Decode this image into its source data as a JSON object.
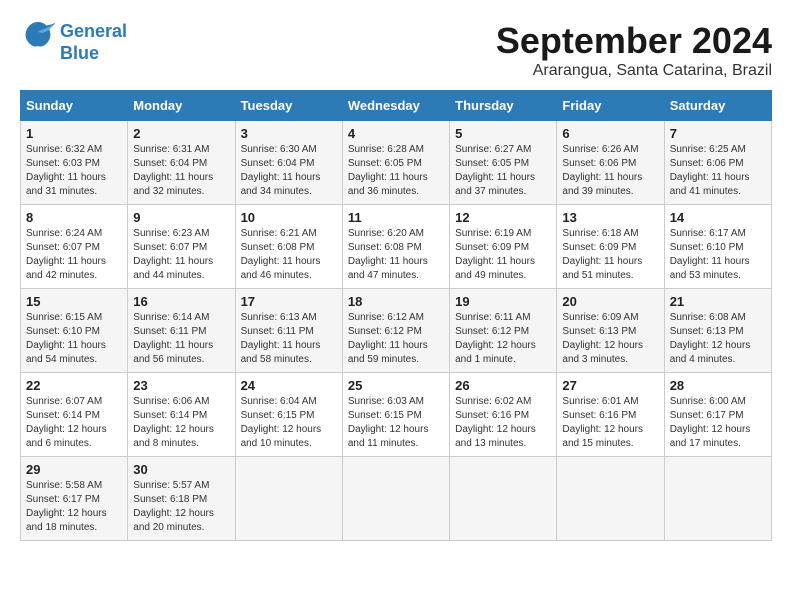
{
  "header": {
    "logo_line1": "General",
    "logo_line2": "Blue",
    "month_year": "September 2024",
    "location": "Ararangua, Santa Catarina, Brazil"
  },
  "weekdays": [
    "Sunday",
    "Monday",
    "Tuesday",
    "Wednesday",
    "Thursday",
    "Friday",
    "Saturday"
  ],
  "weeks": [
    [
      {
        "day": "1",
        "sunrise": "6:32 AM",
        "sunset": "6:03 PM",
        "daylight": "11 hours and 31 minutes."
      },
      {
        "day": "2",
        "sunrise": "6:31 AM",
        "sunset": "6:04 PM",
        "daylight": "11 hours and 32 minutes."
      },
      {
        "day": "3",
        "sunrise": "6:30 AM",
        "sunset": "6:04 PM",
        "daylight": "11 hours and 34 minutes."
      },
      {
        "day": "4",
        "sunrise": "6:28 AM",
        "sunset": "6:05 PM",
        "daylight": "11 hours and 36 minutes."
      },
      {
        "day": "5",
        "sunrise": "6:27 AM",
        "sunset": "6:05 PM",
        "daylight": "11 hours and 37 minutes."
      },
      {
        "day": "6",
        "sunrise": "6:26 AM",
        "sunset": "6:06 PM",
        "daylight": "11 hours and 39 minutes."
      },
      {
        "day": "7",
        "sunrise": "6:25 AM",
        "sunset": "6:06 PM",
        "daylight": "11 hours and 41 minutes."
      }
    ],
    [
      {
        "day": "8",
        "sunrise": "6:24 AM",
        "sunset": "6:07 PM",
        "daylight": "11 hours and 42 minutes."
      },
      {
        "day": "9",
        "sunrise": "6:23 AM",
        "sunset": "6:07 PM",
        "daylight": "11 hours and 44 minutes."
      },
      {
        "day": "10",
        "sunrise": "6:21 AM",
        "sunset": "6:08 PM",
        "daylight": "11 hours and 46 minutes."
      },
      {
        "day": "11",
        "sunrise": "6:20 AM",
        "sunset": "6:08 PM",
        "daylight": "11 hours and 47 minutes."
      },
      {
        "day": "12",
        "sunrise": "6:19 AM",
        "sunset": "6:09 PM",
        "daylight": "11 hours and 49 minutes."
      },
      {
        "day": "13",
        "sunrise": "6:18 AM",
        "sunset": "6:09 PM",
        "daylight": "11 hours and 51 minutes."
      },
      {
        "day": "14",
        "sunrise": "6:17 AM",
        "sunset": "6:10 PM",
        "daylight": "11 hours and 53 minutes."
      }
    ],
    [
      {
        "day": "15",
        "sunrise": "6:15 AM",
        "sunset": "6:10 PM",
        "daylight": "11 hours and 54 minutes."
      },
      {
        "day": "16",
        "sunrise": "6:14 AM",
        "sunset": "6:11 PM",
        "daylight": "11 hours and 56 minutes."
      },
      {
        "day": "17",
        "sunrise": "6:13 AM",
        "sunset": "6:11 PM",
        "daylight": "11 hours and 58 minutes."
      },
      {
        "day": "18",
        "sunrise": "6:12 AM",
        "sunset": "6:12 PM",
        "daylight": "11 hours and 59 minutes."
      },
      {
        "day": "19",
        "sunrise": "6:11 AM",
        "sunset": "6:12 PM",
        "daylight": "12 hours and 1 minute."
      },
      {
        "day": "20",
        "sunrise": "6:09 AM",
        "sunset": "6:13 PM",
        "daylight": "12 hours and 3 minutes."
      },
      {
        "day": "21",
        "sunrise": "6:08 AM",
        "sunset": "6:13 PM",
        "daylight": "12 hours and 4 minutes."
      }
    ],
    [
      {
        "day": "22",
        "sunrise": "6:07 AM",
        "sunset": "6:14 PM",
        "daylight": "12 hours and 6 minutes."
      },
      {
        "day": "23",
        "sunrise": "6:06 AM",
        "sunset": "6:14 PM",
        "daylight": "12 hours and 8 minutes."
      },
      {
        "day": "24",
        "sunrise": "6:04 AM",
        "sunset": "6:15 PM",
        "daylight": "12 hours and 10 minutes."
      },
      {
        "day": "25",
        "sunrise": "6:03 AM",
        "sunset": "6:15 PM",
        "daylight": "12 hours and 11 minutes."
      },
      {
        "day": "26",
        "sunrise": "6:02 AM",
        "sunset": "6:16 PM",
        "daylight": "12 hours and 13 minutes."
      },
      {
        "day": "27",
        "sunrise": "6:01 AM",
        "sunset": "6:16 PM",
        "daylight": "12 hours and 15 minutes."
      },
      {
        "day": "28",
        "sunrise": "6:00 AM",
        "sunset": "6:17 PM",
        "daylight": "12 hours and 17 minutes."
      }
    ],
    [
      {
        "day": "29",
        "sunrise": "5:58 AM",
        "sunset": "6:17 PM",
        "daylight": "12 hours and 18 minutes."
      },
      {
        "day": "30",
        "sunrise": "5:57 AM",
        "sunset": "6:18 PM",
        "daylight": "12 hours and 20 minutes."
      },
      null,
      null,
      null,
      null,
      null
    ]
  ],
  "labels": {
    "sunrise": "Sunrise:",
    "sunset": "Sunset:",
    "daylight": "Daylight:"
  }
}
